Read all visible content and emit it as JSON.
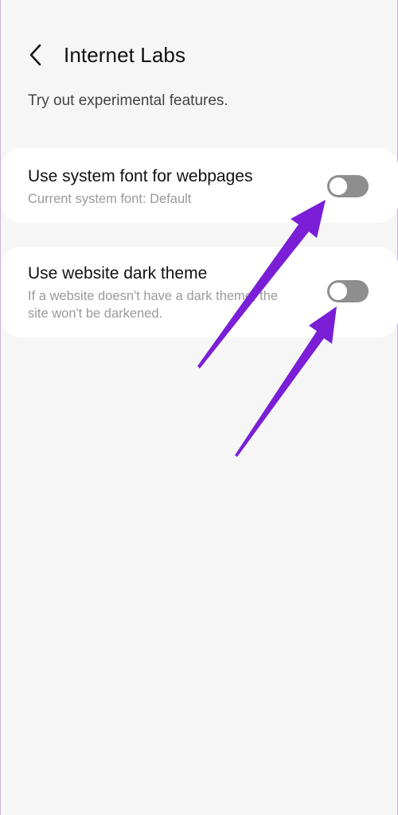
{
  "header": {
    "title": "Internet Labs",
    "back_icon": "chevron-left-icon"
  },
  "subtitle": "Try out experimental features.",
  "settings": [
    {
      "title": "Use system font for webpages",
      "description": "Current system font: Default",
      "enabled": false
    },
    {
      "title": "Use website dark theme",
      "description": "If a website doesn't have a dark theme, the site won't be darkened.",
      "enabled": false
    }
  ],
  "annotation": {
    "arrow_color": "#7a1fd6",
    "count": 2
  }
}
